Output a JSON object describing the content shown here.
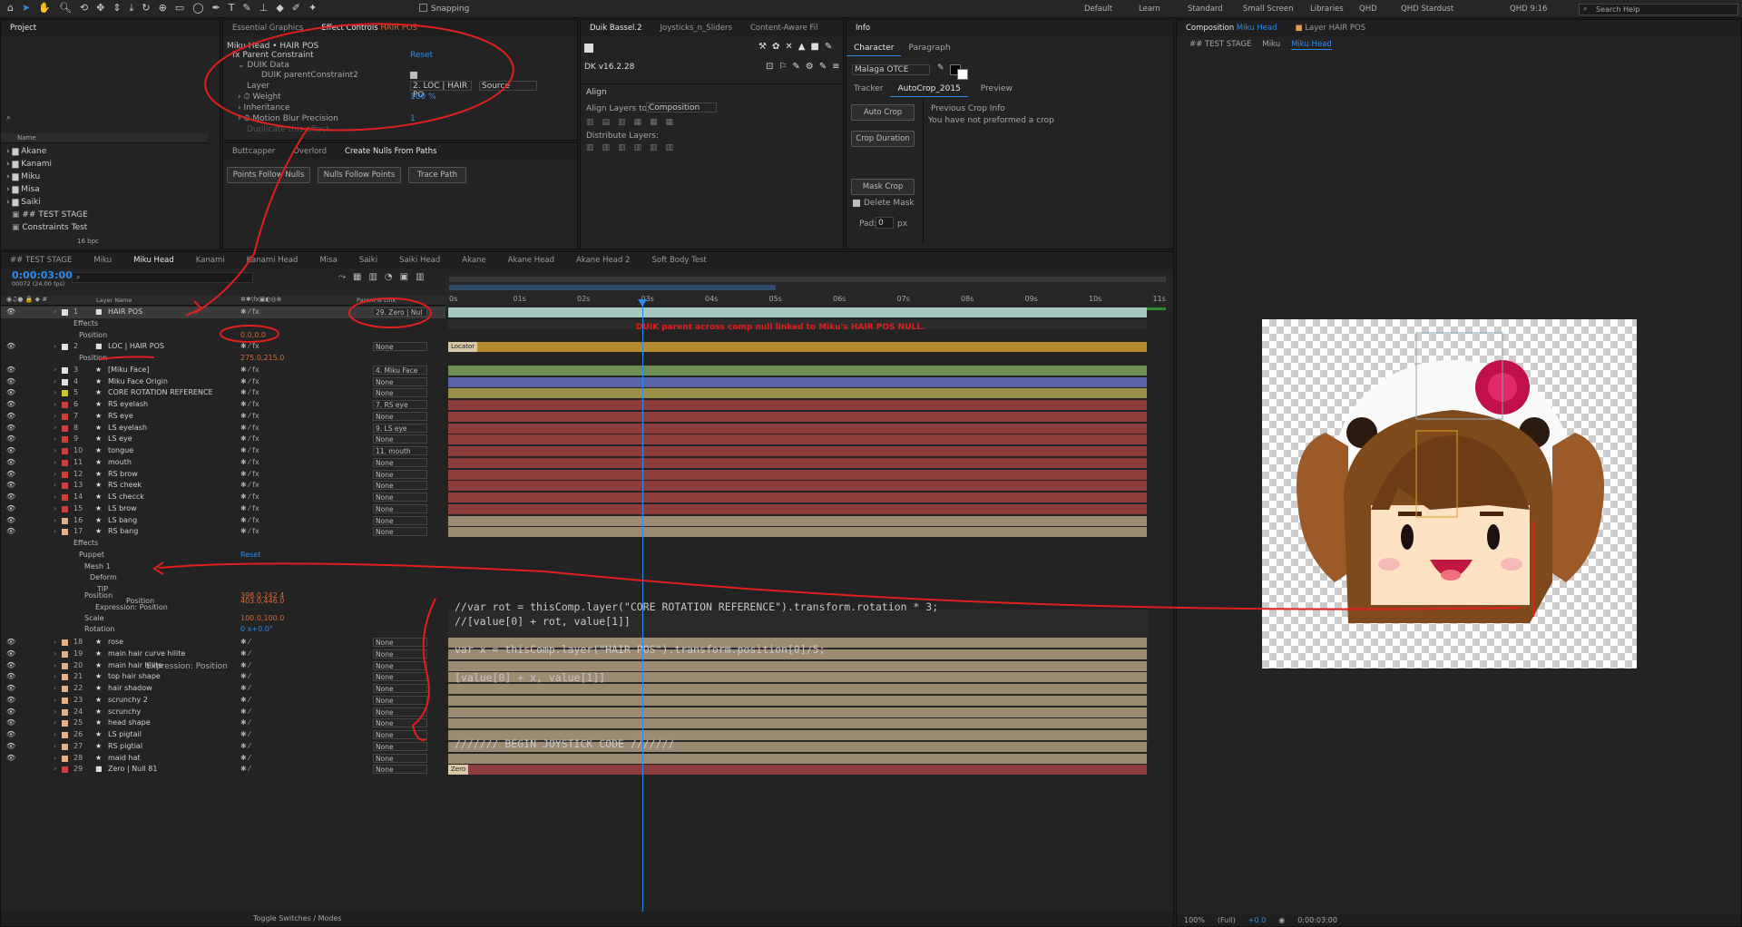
{
  "menubar": {
    "workspaces": [
      "Default",
      "Learn",
      "Standard",
      "Small Screen",
      "Libraries",
      "QHD",
      "QHD Stardust",
      "QHD 9:16"
    ],
    "snapping": "Snapping",
    "search": "Search Help"
  },
  "project": {
    "title": "Project",
    "name_col": "Name",
    "bpc": "16 bpc",
    "items": [
      "Akane",
      "Kanami",
      "Miku",
      "Misa",
      "Saiki",
      "## TEST STAGE",
      "Constraints Test"
    ]
  },
  "effect_controls": {
    "tab1": "Essential Graphics",
    "tab2": "Effect Controls",
    "tab2_target": "HAIR POS",
    "layer_path": "Miku Head • HAIR POS",
    "fx_name": "Parent Constraint",
    "reset": "Reset",
    "duik_data": "DUIK Data",
    "duik_parent": "DUIK parentConstraint2",
    "layer_label": "Layer",
    "layer_value": "2. LOC | HAIR PO",
    "source": "Source",
    "weight_label": "Weight",
    "weight_value": "100",
    "weight_unit": "%",
    "inheritance": "Inheritance",
    "mbp_label": "Motion Blur Precision",
    "mbp_value": "1",
    "faded": "Duplicate this effect"
  },
  "nulls_panel": {
    "tabs": [
      "Buttcapper",
      "Overlord",
      "Create Nulls From Paths"
    ],
    "buttons": [
      "Points Follow Nulls",
      "Nulls Follow Points",
      "Trace Path"
    ]
  },
  "duik": {
    "tabs": [
      "Duik Bassel.2",
      "Joysticks_n_Sliders",
      "Content-Aware Fil"
    ],
    "version": "v16.2.28",
    "align": "Align",
    "align_to_label": "Align Layers to:",
    "align_to_value": "Composition",
    "distribute": "Distribute Layers:"
  },
  "info_panel": {
    "tabs": [
      "Info"
    ],
    "char_tabs": [
      "Character",
      "Paragraph"
    ],
    "font": "Malaga OTCE",
    "sub_tabs": [
      "Tracker",
      "AutoCrop_2015",
      "Preview"
    ],
    "buttons": [
      "Auto Crop",
      "Crop Duration",
      "Mask Crop"
    ],
    "previous": "Previous Crop Info",
    "no_crop": "You have not preformed a crop",
    "delete_mask": "Delete Mask",
    "pad_label": "Pad:",
    "pad_value": "0",
    "pad_unit": "px"
  },
  "comp_viewer": {
    "tab_prefix": "Composition",
    "tab_comp": "Miku Head",
    "layer_tab": "Layer",
    "layer_tab_name": "HAIR POS",
    "breadcrumbs": [
      "## TEST STAGE",
      "Miku",
      "Miku Head"
    ],
    "zoom": "100%",
    "res": "(Full)",
    "offset": "+0.0",
    "time": "0:00:03:00"
  },
  "timeline": {
    "tabs": [
      "## TEST STAGE",
      "Miku",
      "Miku Head",
      "Kanami",
      "Kanami Head",
      "Misa",
      "Saiki",
      "Saiki Head",
      "Akane",
      "Akane Head",
      "Akane Head 2",
      "Soft Body Test"
    ],
    "timecode": "0:00:03:00",
    "frames": "00072 (24.00 fps)",
    "col_layer": "Layer Name",
    "col_parent": "Parent & Link",
    "ruler": [
      "0s",
      "01s",
      "02s",
      "03s",
      "04s",
      "05s",
      "06s",
      "07s",
      "08s",
      "09s",
      "10s",
      "11s"
    ],
    "annotation": "DUIK parent across comp null linked to Miku's HAIR POS NULL.",
    "locator_label": "Locator",
    "zero_label": "Zero",
    "toggle": "Toggle Switches / Modes",
    "props": {
      "effects": "Effects",
      "position": "Position",
      "hairpos_position": "0.0,0.0",
      "loc_position": "275.0,215.0",
      "puppet": "Puppet",
      "puppet_reset": "Reset",
      "mesh": "Mesh 1",
      "deform": "Deform",
      "tip": "TIP",
      "tip_position": "403.0,446.0",
      "expr_label": "Expression: Position",
      "pos2": "398.0,242.4",
      "scale": "Scale",
      "scale_value": "100.0,100.0",
      "scale_unit": "%",
      "rotation": "Rotation",
      "rotation_value": "0 x+0.0°"
    },
    "code": [
      "//var rot = thisComp.layer(\"CORE ROTATION REFERENCE\").transform.rotation * 3;",
      "//[value[0] + rot, value[1]]",
      "",
      "var x = thisComp.layer(\"HAIR POS\").transform.position[0]/5;",
      "",
      "[value[0] + x, value[1]]"
    ],
    "code2": "/////// BEGIN JOYSTICK CODE ///////",
    "layers_top": [
      {
        "n": "1",
        "name": "HAIR POS",
        "color": "#e0e0e0",
        "parent": "29. Zero | Nul",
        "bar": "#a6c6c0"
      },
      {
        "n": "2",
        "name": "LOC | HAIR POS",
        "color": "#e0e0e0",
        "parent": "None",
        "bar": "#b38a2e"
      },
      {
        "n": "3",
        "name": "[Miku Face]",
        "color": "#e0e0e0",
        "parent": "4. Miku Face",
        "bar": "#6e8e58"
      },
      {
        "n": "4",
        "name": "Miku Face Origin",
        "color": "#e0e0e0",
        "parent": "None",
        "bar": "#5965a8"
      },
      {
        "n": "5",
        "name": "CORE ROTATION REFERENCE",
        "color": "#c8c83a",
        "parent": "None",
        "bar": "#9a9048"
      },
      {
        "n": "6",
        "name": "RS eyelash",
        "color": "#c84040",
        "parent": "7. RS eye",
        "bar": "#8d3d3b"
      },
      {
        "n": "7",
        "name": "RS eye",
        "color": "#c84040",
        "parent": "None",
        "bar": "#8d3d3b"
      },
      {
        "n": "8",
        "name": "LS eyelash",
        "color": "#c84040",
        "parent": "9. LS eye",
        "bar": "#8d3d3b"
      },
      {
        "n": "9",
        "name": "LS eye",
        "color": "#c84040",
        "parent": "None",
        "bar": "#8d3d3b"
      },
      {
        "n": "10",
        "name": "tongue",
        "color": "#c84040",
        "parent": "11. mouth",
        "bar": "#8d3d3b"
      },
      {
        "n": "11",
        "name": "mouth",
        "color": "#c84040",
        "parent": "None",
        "bar": "#8d3d3b"
      },
      {
        "n": "12",
        "name": "RS brow",
        "color": "#c84040",
        "parent": "None",
        "bar": "#8d3d3b"
      },
      {
        "n": "13",
        "name": "RS cheek",
        "color": "#c84040",
        "parent": "None",
        "bar": "#8d3d3b"
      },
      {
        "n": "14",
        "name": "LS checck",
        "color": "#c84040",
        "parent": "None",
        "bar": "#8d3d3b"
      },
      {
        "n": "15",
        "name": "LS brow",
        "color": "#c84040",
        "parent": "None",
        "bar": "#8d3d3b"
      },
      {
        "n": "16",
        "name": "LS bang",
        "color": "#e0b08a",
        "parent": "None",
        "bar": "#9d8a72"
      },
      {
        "n": "17",
        "name": "RS bang",
        "color": "#e0b08a",
        "parent": "None",
        "bar": "#9d8a72"
      }
    ],
    "layers_bottom": [
      {
        "n": "18",
        "name": "rose",
        "parent": "None"
      },
      {
        "n": "19",
        "name": "main hair curve hilite",
        "parent": "None"
      },
      {
        "n": "20",
        "name": "main hair hilite",
        "parent": "None"
      },
      {
        "n": "21",
        "name": "top hair shape",
        "parent": "None"
      },
      {
        "n": "22",
        "name": "hair shadow",
        "parent": "None"
      },
      {
        "n": "23",
        "name": "scrunchy 2",
        "parent": "None"
      },
      {
        "n": "24",
        "name": "scrunchy",
        "parent": "None"
      },
      {
        "n": "25",
        "name": "head shape",
        "parent": "None"
      },
      {
        "n": "26",
        "name": "LS pigtail",
        "parent": "None"
      },
      {
        "n": "27",
        "name": "RS pigtial",
        "parent": "None"
      },
      {
        "n": "28",
        "name": "maid hat",
        "parent": "None"
      },
      {
        "n": "29",
        "name": "Zero | Null 81",
        "parent": "None"
      }
    ]
  },
  "colors": {
    "accent": "#2d8ceb",
    "annotation": "#e0201c",
    "bg": "#1d1d1d"
  }
}
